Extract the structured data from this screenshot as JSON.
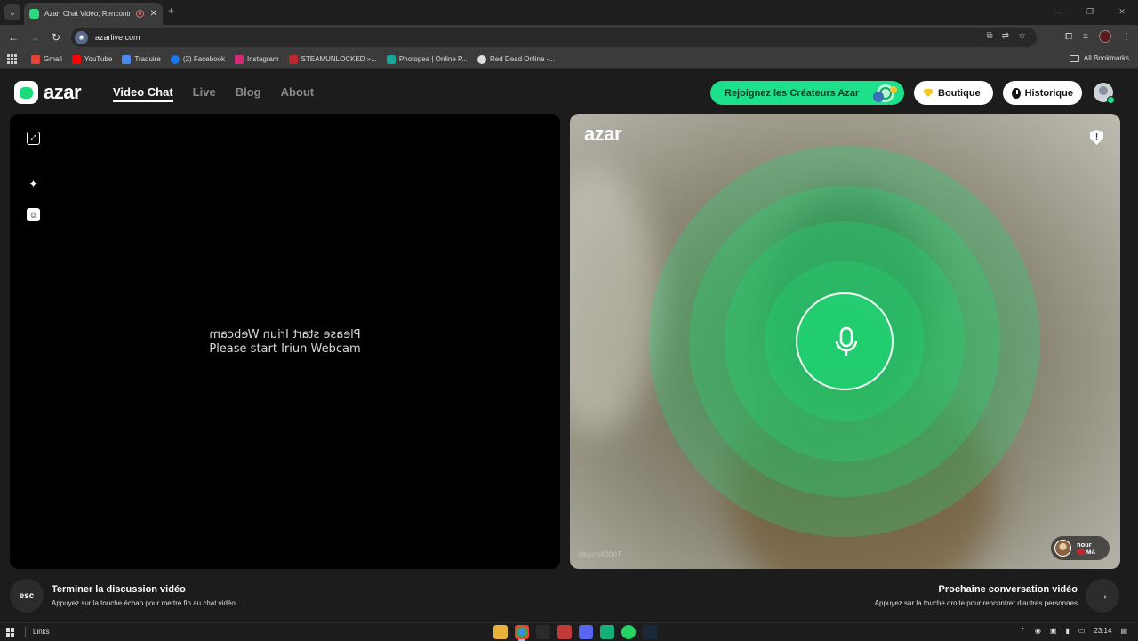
{
  "browser": {
    "tab_title": "Azar: Chat Vidéo, Rencontre",
    "url": "azarlive.com",
    "bookmarks": [
      {
        "label": "Gmail",
        "icon": "gmail-icon",
        "color": "#ea4335"
      },
      {
        "label": "YouTube",
        "icon": "youtube-icon",
        "color": "#ff0000"
      },
      {
        "label": "Traduire",
        "icon": "translate-icon",
        "color": "#4a8af4"
      },
      {
        "label": "(2) Facebook",
        "icon": "facebook-icon",
        "color": "#1877f2"
      },
      {
        "label": "Instagram",
        "icon": "instagram-icon",
        "color": "#d62976"
      },
      {
        "label": "STEAMUNLOCKED »...",
        "icon": "steamunlocked-icon",
        "color": "#c0262c"
      },
      {
        "label": "Photopea | Online P...",
        "icon": "photopea-icon",
        "color": "#18a497"
      },
      {
        "label": "Red Dead Online -...",
        "icon": "reddead-icon",
        "color": "#dddddd"
      }
    ],
    "all_bookmarks": "All Bookmarks"
  },
  "header": {
    "logo_text": "azar",
    "nav": [
      "Video Chat",
      "Live",
      "Blog",
      "About"
    ],
    "creators_label": "Rejoignez les Créateurs Azar",
    "shop_label": "Boutique",
    "history_label": "Historique"
  },
  "left_panel": {
    "webcam_message": "Please start Iriun Webcam"
  },
  "right_panel": {
    "logo_text": "azar",
    "user_id": "@kqceAOQoT",
    "partner_name": "nour",
    "partner_country": "MA"
  },
  "footer": {
    "esc_label": "esc",
    "end_title": "Terminer la discussion vidéo",
    "end_sub": "Appuyez sur la touche échap pour mettre fin au chat vidéo.",
    "next_title": "Prochaine conversation vidéo",
    "next_sub": "Appuyez sur la touche droite pour rencontrer d'autres personnes"
  },
  "taskbar": {
    "links_label": "Links",
    "time": "23:14"
  },
  "colors": {
    "accent_green": "#1de08a",
    "page_bg": "#1c1c1c"
  }
}
